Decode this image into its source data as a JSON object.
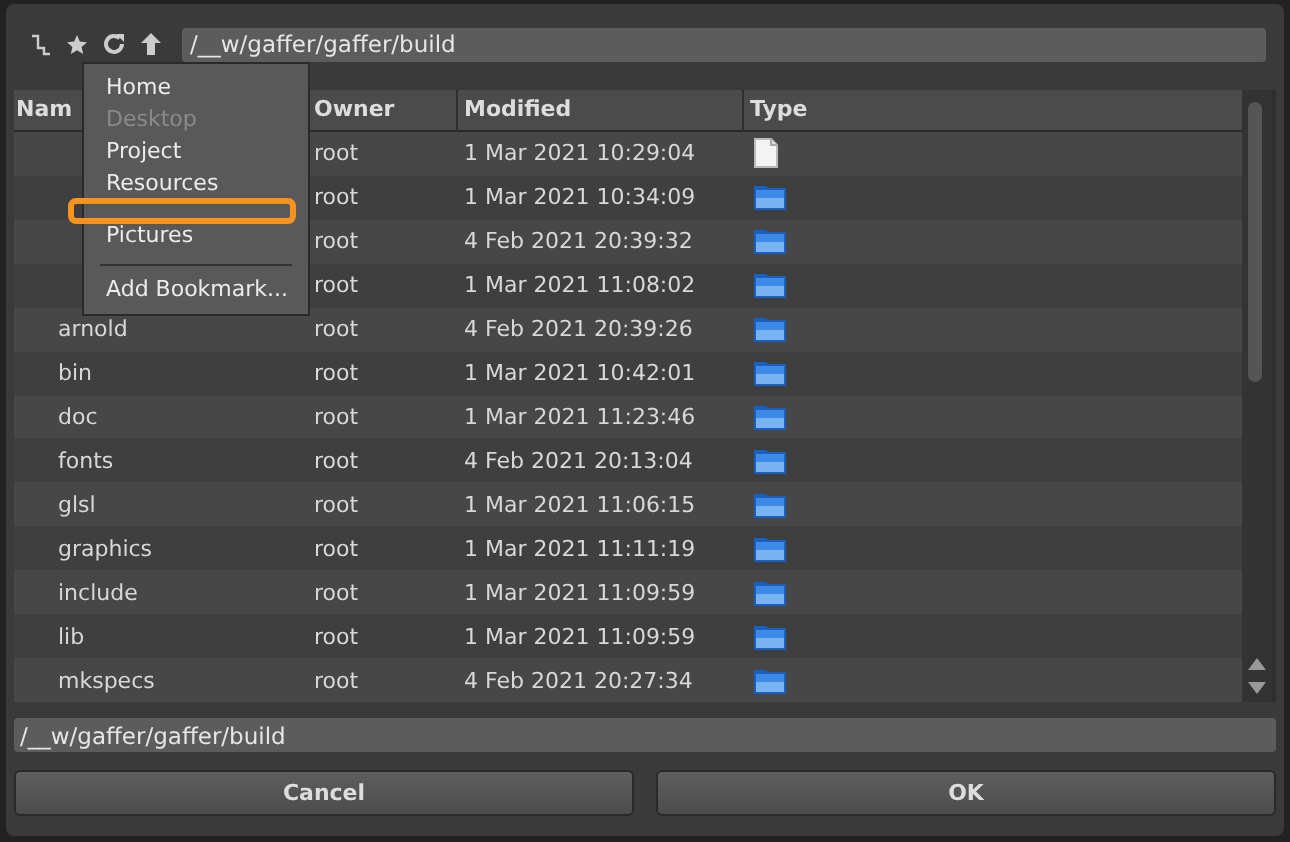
{
  "toolbar": {
    "path": "/__w/gaffer/gaffer/build"
  },
  "table": {
    "columns": [
      "Nam",
      "Owner",
      "Modified",
      "Type"
    ],
    "rows": [
      {
        "owner": "root",
        "modified": "1 Mar 2021 10:29:04",
        "kind": "file"
      },
      {
        "owner": "root",
        "modified": "1 Mar 2021 10:34:09",
        "kind": "folder"
      },
      {
        "owner": "root",
        "modified": "4 Feb 2021 20:39:32",
        "kind": "folder"
      },
      {
        "owner": "root",
        "modified": "1 Mar 2021 11:08:02",
        "kind": "folder"
      },
      {
        "name": "arnold",
        "owner": "root",
        "modified": "4 Feb 2021 20:39:26",
        "kind": "folder"
      },
      {
        "name": "bin",
        "owner": "root",
        "modified": "1 Mar 2021 10:42:01",
        "kind": "folder"
      },
      {
        "name": "doc",
        "owner": "root",
        "modified": "1 Mar 2021 11:23:46",
        "kind": "folder"
      },
      {
        "name": "fonts",
        "owner": "root",
        "modified": "4 Feb 2021 20:13:04",
        "kind": "folder"
      },
      {
        "name": "glsl",
        "owner": "root",
        "modified": "1 Mar 2021 11:06:15",
        "kind": "folder"
      },
      {
        "name": "graphics",
        "owner": "root",
        "modified": "1 Mar 2021 11:11:19",
        "kind": "folder"
      },
      {
        "name": "include",
        "owner": "root",
        "modified": "1 Mar 2021 11:09:59",
        "kind": "folder"
      },
      {
        "name": "lib",
        "owner": "root",
        "modified": "1 Mar 2021 11:09:59",
        "kind": "folder"
      },
      {
        "name": "mkspecs",
        "owner": "root",
        "modified": "4 Feb 2021 20:27:34",
        "kind": "folder"
      }
    ]
  },
  "bookmark_menu": {
    "items": [
      {
        "label": "Home",
        "disabled": false
      },
      {
        "label": "Desktop",
        "disabled": true
      },
      {
        "label": "Project",
        "disabled": false
      },
      {
        "label": "Resources",
        "disabled": false
      },
      {
        "label": "Pictures",
        "disabled": false
      },
      {
        "kind": "separator"
      },
      {
        "label": "Add Bookmark...",
        "disabled": false
      }
    ]
  },
  "path_field": {
    "value": "/__w/gaffer/gaffer/build"
  },
  "buttons": [
    "Cancel",
    "OK"
  ]
}
